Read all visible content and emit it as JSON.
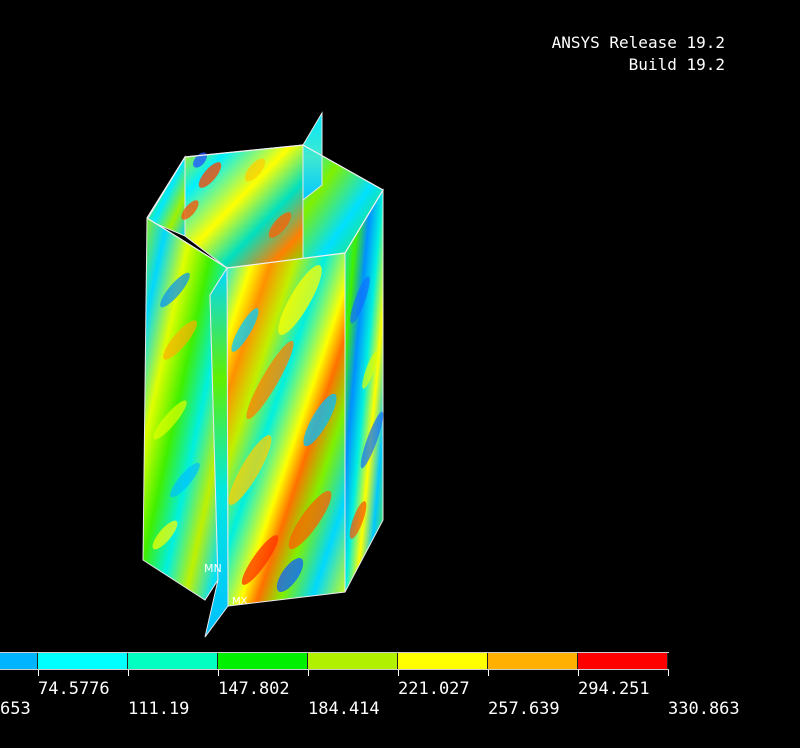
{
  "header": {
    "release": "ANSYS Release 19.2",
    "build": "Build 19.2"
  },
  "markers": {
    "min": "MN",
    "max": "MX"
  },
  "legend": {
    "upper_labels": [
      "74.5776",
      "147.802",
      "221.027",
      "294.251"
    ],
    "lower_labels": [
      "653",
      "111.19",
      "184.414",
      "257.639",
      "330.863"
    ],
    "colors": [
      "#00b4ff",
      "#00ffff",
      "#00ffc0",
      "#00f000",
      "#b0f000",
      "#ffff00",
      "#ffb000",
      "#ff0000"
    ]
  },
  "colors": {
    "background": "#000000",
    "text": "#ffffff",
    "edge": "#e8e8e8"
  }
}
